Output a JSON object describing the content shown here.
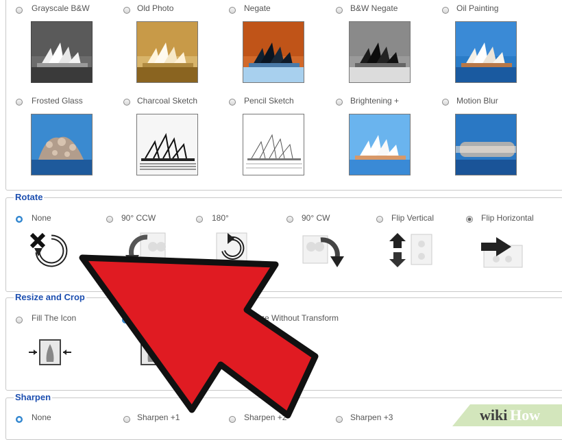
{
  "effects": {
    "row1": [
      {
        "label": "Grayscale B&W",
        "icon": "grayscale-thumbnail"
      },
      {
        "label": "Old Photo",
        "icon": "old-photo-thumbnail"
      },
      {
        "label": "Negate",
        "icon": "negate-thumbnail"
      },
      {
        "label": "B&W Negate",
        "icon": "bw-negate-thumbnail"
      },
      {
        "label": "Oil Painting",
        "icon": "oil-painting-thumbnail"
      }
    ],
    "row2": [
      {
        "label": "Frosted Glass",
        "icon": "frosted-glass-thumbnail"
      },
      {
        "label": "Charcoal Sketch",
        "icon": "charcoal-sketch-thumbnail"
      },
      {
        "label": "Pencil Sketch",
        "icon": "pencil-sketch-thumbnail"
      },
      {
        "label": "Brightening +",
        "icon": "brightening-thumbnail"
      },
      {
        "label": "Motion Blur",
        "icon": "motion-blur-thumbnail"
      }
    ]
  },
  "rotate": {
    "title": "Rotate",
    "selected": "None",
    "options": [
      {
        "label": "None",
        "icon": "rotate-none-icon"
      },
      {
        "label": "90° CCW",
        "icon": "rotate-ccw-icon"
      },
      {
        "label": "180°",
        "icon": "rotate-180-icon"
      },
      {
        "label": "90° CW",
        "icon": "rotate-cw-icon"
      },
      {
        "label": "Flip Vertical",
        "icon": "flip-vertical-icon"
      },
      {
        "label": "Flip Horizontal",
        "icon": "flip-horizontal-icon"
      }
    ]
  },
  "resize": {
    "title": "Resize and Crop",
    "options": [
      {
        "label": "Fill The Icon",
        "icon": "fill-icon-icon"
      },
      {
        "label": "",
        "icon": "crop-icon"
      },
      {
        "label": "Resize Without Transform",
        "icon": "resize-icon"
      }
    ]
  },
  "sharpen": {
    "title": "Sharpen",
    "selected": "None",
    "options": [
      {
        "label": "None"
      },
      {
        "label": "Sharpen +1"
      },
      {
        "label": "Sharpen +2"
      },
      {
        "label": "Sharpen +3"
      }
    ]
  },
  "watermark": {
    "wiki": "wiki",
    "how": "How"
  },
  "colors": {
    "accent": "#1d4fb0",
    "arrow": "#e01b22",
    "selected_radio": "#2d7fc8"
  }
}
